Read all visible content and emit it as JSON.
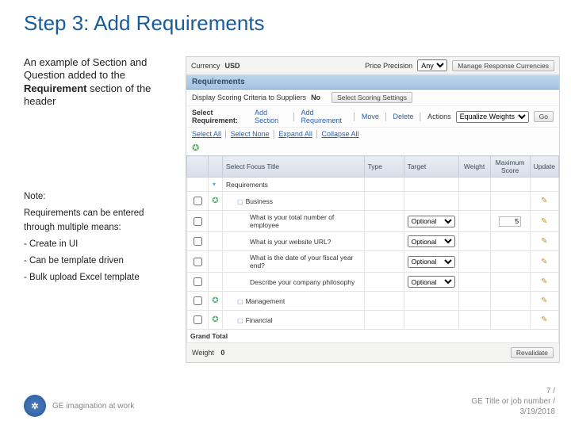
{
  "slide": {
    "title": "Step 3: Add Requirements",
    "intro_plain1": "An example of Section and Question added to the ",
    "intro_bold": "Requirement",
    "intro_plain2": " section of the header",
    "note_heading": "Note:",
    "note_line1": "Requirements can be entered through multiple means:",
    "note_b1": "- Create in UI",
    "note_b2": "- Can be template driven",
    "note_b3": "- Bulk upload Excel template"
  },
  "app": {
    "currency_label": "Currency",
    "currency_value": "USD",
    "price_precision_label": "Price Precision",
    "price_precision_value": "Any",
    "manage_currencies_btn": "Manage Response Currencies",
    "section_header": "Requirements",
    "display_scoring_label": "Display Scoring Criteria to Suppliers",
    "display_scoring_value": "No",
    "select_scoring_btn": "Select Scoring Settings",
    "select_requirement_label": "Select Requirement:",
    "add_section": "Add Section",
    "add_requirement": "Add Requirement",
    "move": "Move",
    "delete": "Delete",
    "actions_label": "Actions",
    "actions_value": "Equalize Weights",
    "go_btn": "Go",
    "expand_all": "Expand All",
    "collapse_all": "Collapse All",
    "select_all": "Select All",
    "select_none": "Select None",
    "cols": {
      "title": "Select Focus Title",
      "type": "Type",
      "target": "Target",
      "weight": "Weight",
      "mscore": "Maximum Score",
      "update": "Update"
    },
    "tgt_optional": "Optional",
    "rows": {
      "r_root": "Requirements",
      "r_business": "Business",
      "r_q1": "What is your total number of employee",
      "r_q2": "What is your website URL?",
      "r_q3": "What is the date of your fiscal year end?",
      "r_q4": "Describe your company philosophy",
      "r_mgmt": "Management",
      "r_fin": "Financial"
    },
    "mscore_val": "5",
    "grand_total": "Grand Total",
    "weight_label": "Weight",
    "weight_val": "0",
    "revalidate_btn": "Revalidate"
  },
  "footer": {
    "tagline": "GE imagination at work",
    "page": "7 /",
    "line2": "GE Title or job number /",
    "date": "3/19/2018"
  }
}
